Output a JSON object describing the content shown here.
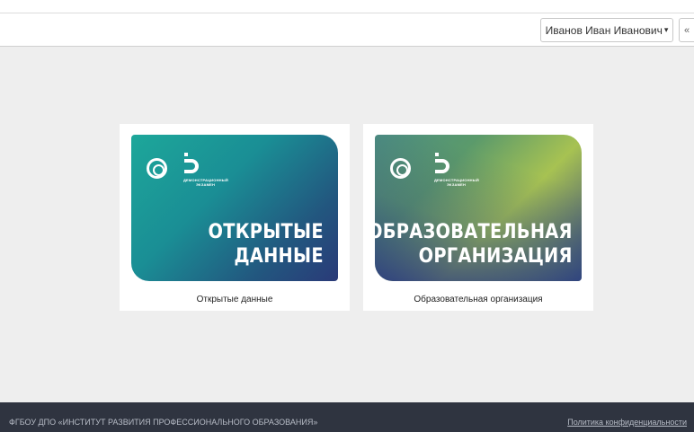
{
  "header": {
    "user_name": "Иванов Иван Иванович",
    "user_caret": "▾",
    "collapse_symbol": "«"
  },
  "cards": [
    {
      "banner_lines": [
        "ОТКРЫТЫЕ",
        "ДАННЫЕ"
      ],
      "caption": "Открытые данные",
      "logo_text": [
        "ДЕМОНСТРАЦИОННЫЙ",
        "ЭКЗАМЕН"
      ]
    },
    {
      "banner_lines": [
        "ОБРАЗОВАТЕЛЬНАЯ",
        "ОРГАНИЗАЦИЯ"
      ],
      "caption": "Образовательная организация",
      "logo_text": [
        "ДЕМОНСТРАЦИОННЫЙ",
        "ЭКЗАМЕН"
      ]
    }
  ],
  "footer": {
    "org": "ФГБОУ ДПО «ИНСТИТУТ РАЗВИТИЯ ПРОФЕССИОНАЛЬНОГО ОБРАЗОВАНИЯ»",
    "privacy_link": "Политика конфиденциальности"
  },
  "colors": {
    "background": "#eeeeee",
    "footer": "#2f3440",
    "card1_gradient_start": "#1da79a",
    "card1_gradient_end": "#2a3a78",
    "card2_gradient_light": "#a7c252",
    "card2_gradient_dark": "#2b3a82"
  },
  "icons": {
    "emblem": "round-emblem-icon",
    "demo_logo": "demo-exam-logo-icon"
  }
}
